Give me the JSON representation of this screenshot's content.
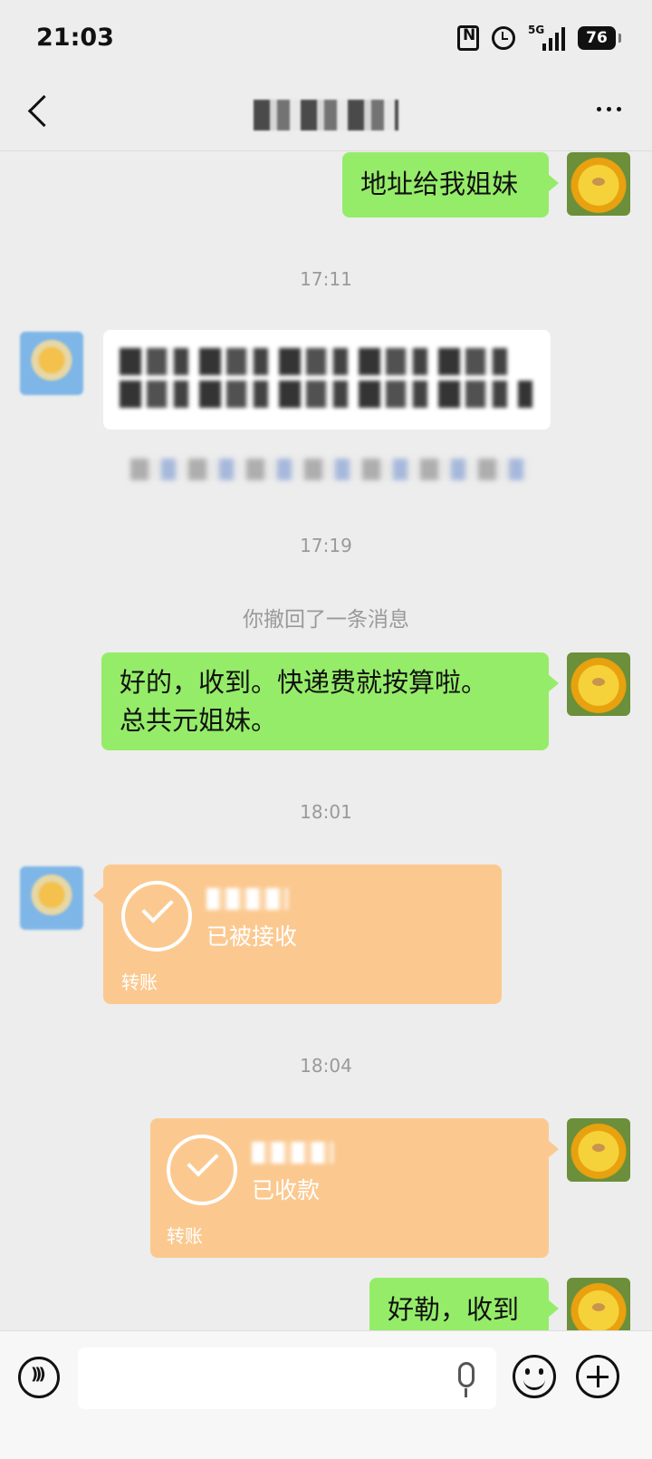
{
  "status_bar": {
    "time": "21:03",
    "network_label": "5G",
    "battery_level": "76"
  },
  "header": {
    "title_redacted": true,
    "icons": [
      "back-icon",
      "more-icon"
    ]
  },
  "messages": [
    {
      "type": "text",
      "sender": "self",
      "text": "地址给我姐妹"
    },
    {
      "type": "timestamp",
      "text": "17:11"
    },
    {
      "type": "text",
      "sender": "other",
      "text_redacted": true
    },
    {
      "type": "timestamp",
      "text": "17:19"
    },
    {
      "type": "system",
      "text": "你撤回了一条消息"
    },
    {
      "type": "text",
      "sender": "self",
      "line1": "好的，收到。快递费就按算啦。",
      "line2": "总共元姐妹。"
    },
    {
      "type": "timestamp",
      "text": "18:01"
    },
    {
      "type": "transfer",
      "sender": "other",
      "status": "已被接收",
      "label": "转账"
    },
    {
      "type": "timestamp",
      "text": "18:04"
    },
    {
      "type": "transfer",
      "sender": "self",
      "status": "已收款",
      "label": "转账"
    },
    {
      "type": "text",
      "sender": "self",
      "text": "好勒，收到"
    }
  ],
  "input_bar": {
    "placeholder": "",
    "icons": [
      "voice-icon",
      "mic-icon",
      "emoji-icon",
      "plus-icon"
    ]
  },
  "colors": {
    "background": "#ededed",
    "self_bubble": "#95ec69",
    "other_bubble": "#ffffff",
    "transfer_bubble": "#fbc990",
    "timestamp_text": "#9a9a9a"
  }
}
